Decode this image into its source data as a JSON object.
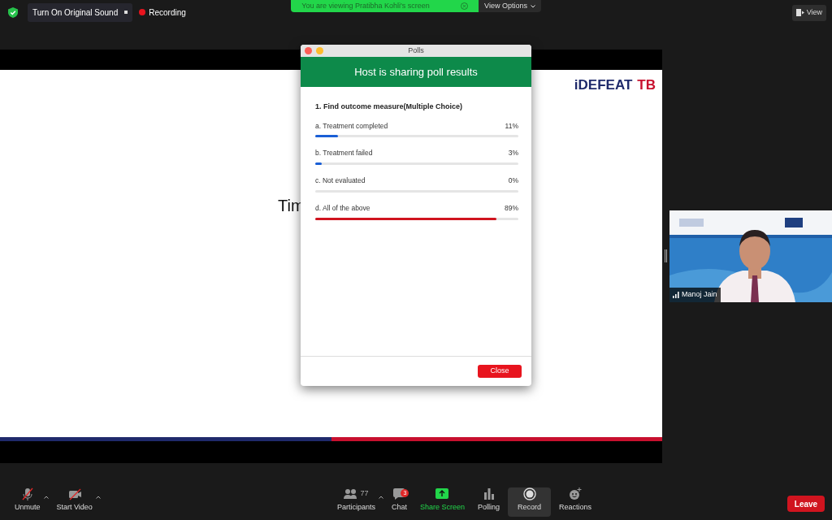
{
  "top_bar": {
    "original_sound_button": "Turn On Original Sound",
    "recording_label": "Recording",
    "viewing_banner": "You are viewing Pratibha Kohli's screen",
    "view_options": "View Options",
    "view_button": "View"
  },
  "slide": {
    "logo_parts": [
      {
        "text": "iDEFEAT",
        "color": "#1f2a6b"
      },
      {
        "text": "TB",
        "color": "#c8102e"
      }
    ],
    "text": "Tim"
  },
  "poll": {
    "window_title": "Polls",
    "header": "Host is sharing poll results",
    "question": "1. Find outcome measure(Multiple Choice)",
    "options": [
      {
        "label": "a. Treatment completed",
        "percent": "11%",
        "level": 0.11,
        "color": "#1a5fd6"
      },
      {
        "label": "b. Treatment failed",
        "percent": "3%",
        "level": 0.03,
        "color": "#1a5fd6"
      },
      {
        "label": "c. Not evaluated",
        "percent": "0%",
        "level": 0
      },
      {
        "label": "d. All of the above",
        "percent": "89%",
        "level": 0.89,
        "color": "#d0141f"
      }
    ],
    "close_button": "Close"
  },
  "video": {
    "kind": "picture",
    "name": "Manoj Jain"
  },
  "toolbar": [
    {
      "kind": "mic",
      "label": "Unmute",
      "off": true,
      "caret": true,
      "highlighted": false
    },
    {
      "kind": "camera",
      "label": "Start Video",
      "off": true,
      "caret": true,
      "highlighted": false
    },
    {
      "kind": "participants",
      "label": "Participants",
      "count": "77",
      "caret": true,
      "highlighted": false
    },
    {
      "kind": "chat",
      "label": "Chat",
      "badge": "3",
      "highlighted": false
    },
    {
      "kind": "share",
      "label": "Share Screen",
      "highlighted": false
    },
    {
      "kind": "polling",
      "label": "Polling",
      "highlighted": false
    },
    {
      "kind": "record",
      "label": "Record",
      "highlighted": true
    },
    {
      "kind": "reactions",
      "label": "Reactions",
      "highlighted": false
    }
  ],
  "leave_button": "Leave"
}
